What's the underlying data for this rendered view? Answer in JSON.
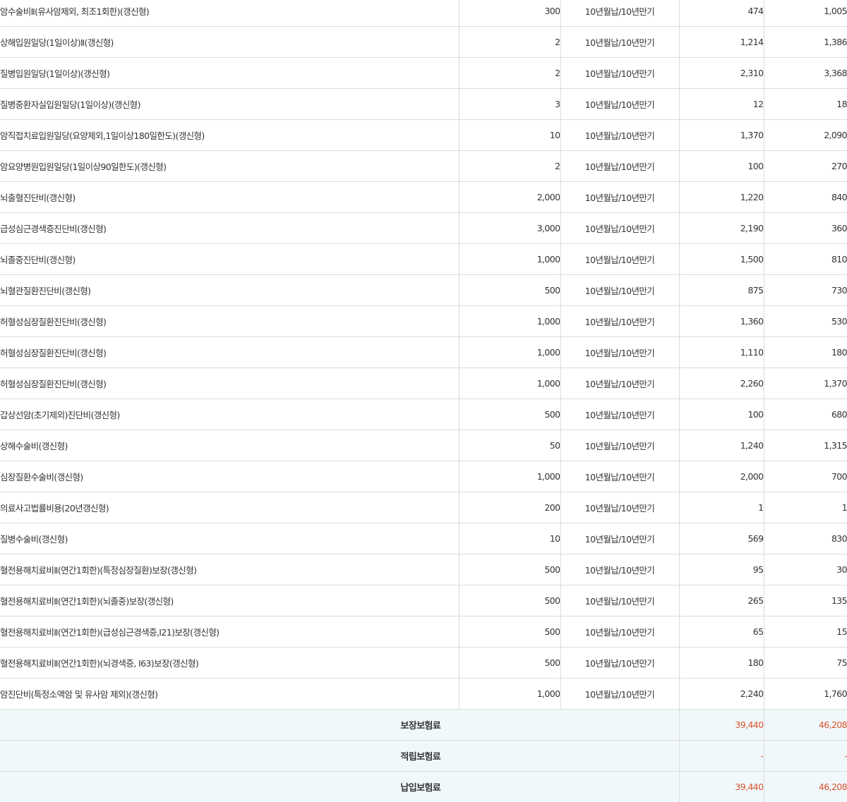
{
  "period_label": "10년월납/10년만기",
  "rows": [
    {
      "name": "암수술비Ⅱ(유사암제외, 최조1회한)(갱신형)",
      "amount": "300",
      "p1": "474",
      "p2": "1,005"
    },
    {
      "name": "상해입원일당(1일이상)Ⅱ(갱신형)",
      "amount": "2",
      "p1": "1,214",
      "p2": "1,386"
    },
    {
      "name": "질병입원일당(1일이상)(갱신형)",
      "amount": "2",
      "p1": "2,310",
      "p2": "3,368"
    },
    {
      "name": "질병중환자실입원일당(1일이상)(갱신형)",
      "amount": "3",
      "p1": "12",
      "p2": "18"
    },
    {
      "name": "암직접치료입원일당(요양제외,1일이상180일한도)(갱신형)",
      "amount": "10",
      "p1": "1,370",
      "p2": "2,090"
    },
    {
      "name": "암요양병원입원일당(1일이상90일한도)(갱신형)",
      "amount": "2",
      "p1": "100",
      "p2": "270"
    },
    {
      "name": "뇌출혈진단비(갱신형)",
      "amount": "2,000",
      "p1": "1,220",
      "p2": "840"
    },
    {
      "name": "급성심근경색증진단비(갱신형)",
      "amount": "3,000",
      "p1": "2,190",
      "p2": "360"
    },
    {
      "name": "뇌졸중진단비(갱신형)",
      "amount": "1,000",
      "p1": "1,500",
      "p2": "810"
    },
    {
      "name": "뇌혈관질환진단비(갱신형)",
      "amount": "500",
      "p1": "875",
      "p2": "730"
    },
    {
      "name": "허혈성심장질환진단비(갱신형)",
      "amount": "1,000",
      "p1": "1,360",
      "p2": "530"
    },
    {
      "name": "허혈성심장질환진단비(갱신형)",
      "amount": "1,000",
      "p1": "1,110",
      "p2": "180"
    },
    {
      "name": "허혈성심장질환진단비(갱신형)",
      "amount": "1,000",
      "p1": "2,260",
      "p2": "1,370"
    },
    {
      "name": "갑상선암(초기제외)진단비(갱신형)",
      "amount": "500",
      "p1": "100",
      "p2": "680"
    },
    {
      "name": "상해수술비(갱신형)",
      "amount": "50",
      "p1": "1,240",
      "p2": "1,315"
    },
    {
      "name": "심장질환수술비(갱신형)",
      "amount": "1,000",
      "p1": "2,000",
      "p2": "700"
    },
    {
      "name": "의료사고법률비용(20년갱신형)",
      "amount": "200",
      "p1": "1",
      "p2": "1"
    },
    {
      "name": "질병수술비(갱신형)",
      "amount": "10",
      "p1": "569",
      "p2": "830"
    },
    {
      "name": "혈전용해치료비Ⅱ(연간1회한)(특정심장질환)보장(갱신형)",
      "amount": "500",
      "p1": "95",
      "p2": "30"
    },
    {
      "name": "혈전용해치료비Ⅱ(연간1회한)(뇌졸중)보장(갱신형)",
      "amount": "500",
      "p1": "265",
      "p2": "135"
    },
    {
      "name": "혈전용해치료비Ⅱ(연간1회한)(급성심근경색증,I21)보장(갱신형)",
      "amount": "500",
      "p1": "65",
      "p2": "15"
    },
    {
      "name": "혈전용해치료비Ⅱ(연간1회한)(뇌경색증, I63)보장(갱신형)",
      "amount": "500",
      "p1": "180",
      "p2": "75"
    },
    {
      "name": "암진단비(특정소액암 및 유사암 제외)(갱신형)",
      "amount": "1,000",
      "p1": "2,240",
      "p2": "1,760"
    }
  ],
  "summary": [
    {
      "label": "보장보험료",
      "p1": "39,440",
      "p2": "46,208"
    },
    {
      "label": "적립보험료",
      "p1": "-",
      "p2": "-"
    },
    {
      "label": "납입보험료",
      "p1": "39,440",
      "p2": "46,208"
    }
  ],
  "colors": {
    "summary_background": "#f1f8fb",
    "summary_value": "#d9532c",
    "border": "#dcdcdc",
    "text": "#333333"
  }
}
